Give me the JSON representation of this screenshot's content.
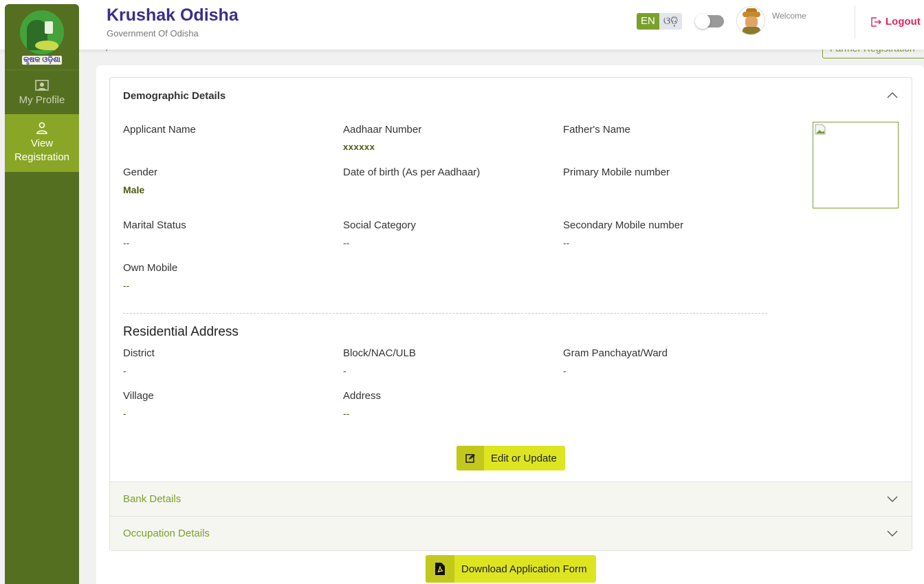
{
  "header": {
    "title": "Krushak Odisha",
    "subtitle": "Government Of Odisha",
    "lang_en": "EN",
    "lang_od": "ଓଡ଼ି",
    "welcome": "Welcome",
    "logout": "Logout"
  },
  "sidebar": {
    "logo_text": "କୃଷକ ଓଡ଼ିଶା",
    "items": [
      {
        "label": "My Profile",
        "icon": "profile-card-icon",
        "active": false
      },
      {
        "label": "View Registration",
        "icon": "user-icon",
        "active": true
      }
    ]
  },
  "page": {
    "breadcrumb_fragment": "--   /",
    "farmer_registration_button": "Farmer Registration"
  },
  "demographic": {
    "title": "Demographic Details",
    "fields": [
      {
        "label": "Applicant Name",
        "value": ""
      },
      {
        "label": "Aadhaar Number",
        "value": "xxxxxx"
      },
      {
        "label": "Father's Name",
        "value": ""
      },
      {
        "label": "Gender",
        "value": "Male"
      },
      {
        "label": "Date of birth (As per Aadhaar)",
        "value": ""
      },
      {
        "label": "Primary Mobile number",
        "value": ""
      },
      {
        "label": "Marital Status",
        "value": "--"
      },
      {
        "label": "Social Category",
        "value": "--"
      },
      {
        "label": "Secondary Mobile number",
        "value": "--"
      },
      {
        "label": "Own Mobile",
        "value": "--"
      }
    ],
    "address_title": "Residential Address",
    "address_fields": [
      {
        "label": "District",
        "value": "-"
      },
      {
        "label": "Block/NAC/ULB",
        "value": "-"
      },
      {
        "label": "Gram Panchayat/Ward",
        "value": "-"
      },
      {
        "label": "Village",
        "value": "-"
      },
      {
        "label": "Address",
        "value": "--"
      }
    ],
    "edit_button": "Edit or Update"
  },
  "sections": [
    {
      "title": "Bank Details"
    },
    {
      "title": "Occupation Details"
    }
  ],
  "download_button": "Download Application Form",
  "colors": {
    "sidebar": "#556f21",
    "sidebar_active": "#8aa626",
    "brand_title": "#3a2f8a",
    "accent_green": "#7aa02c",
    "button_yellow": "#dde521",
    "logout_red": "#e0245e"
  }
}
